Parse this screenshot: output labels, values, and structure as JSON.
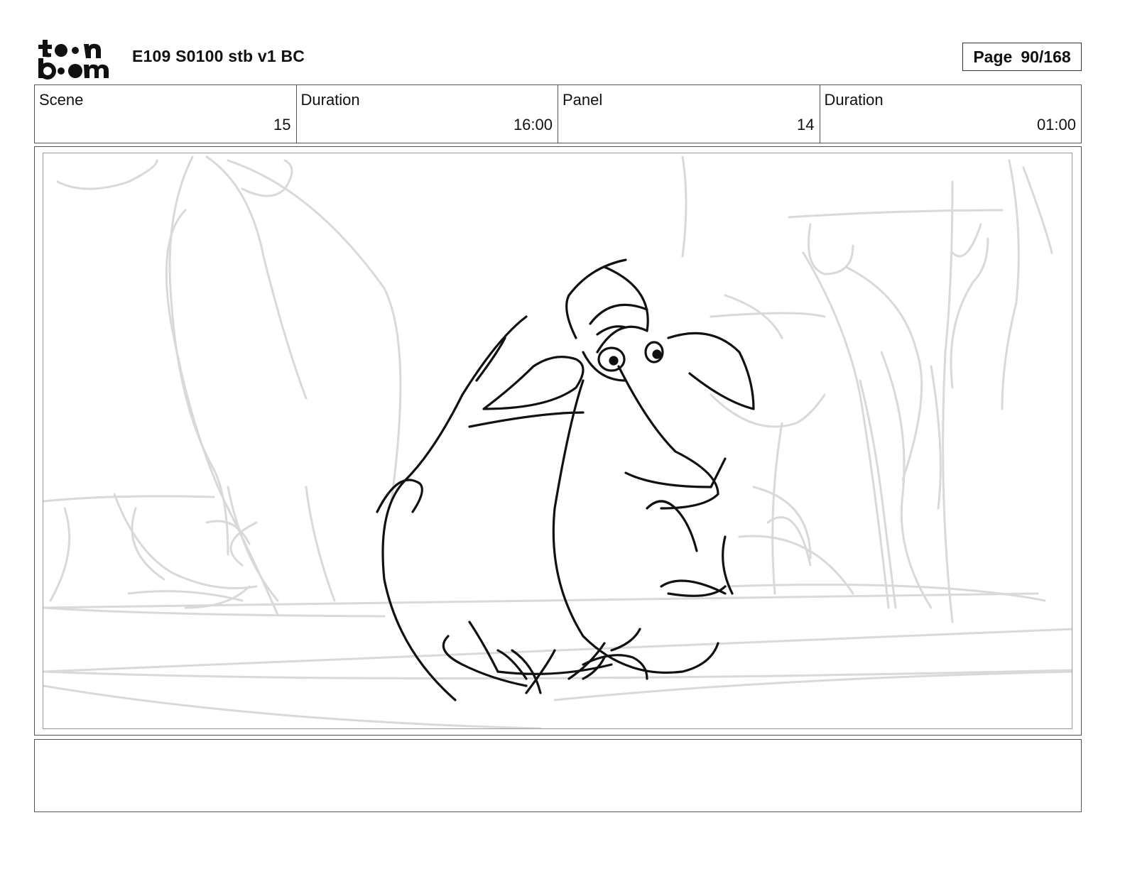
{
  "header": {
    "logo_alt": "toon boom",
    "title": "E109 S0100 stb v1 BC",
    "page_label": "Page",
    "page_value": "90/168"
  },
  "info": {
    "scene_label": "Scene",
    "scene_value": "15",
    "scene_duration_label": "Duration",
    "scene_duration_value": "16:00",
    "panel_label": "Panel",
    "panel_value": "14",
    "panel_duration_label": "Duration",
    "panel_duration_value": "01:00"
  },
  "panel": {
    "subject": "sheep",
    "ink_color": "#111111",
    "background_sketch_color": "#d9d9d9"
  },
  "notes": {
    "text": ""
  }
}
